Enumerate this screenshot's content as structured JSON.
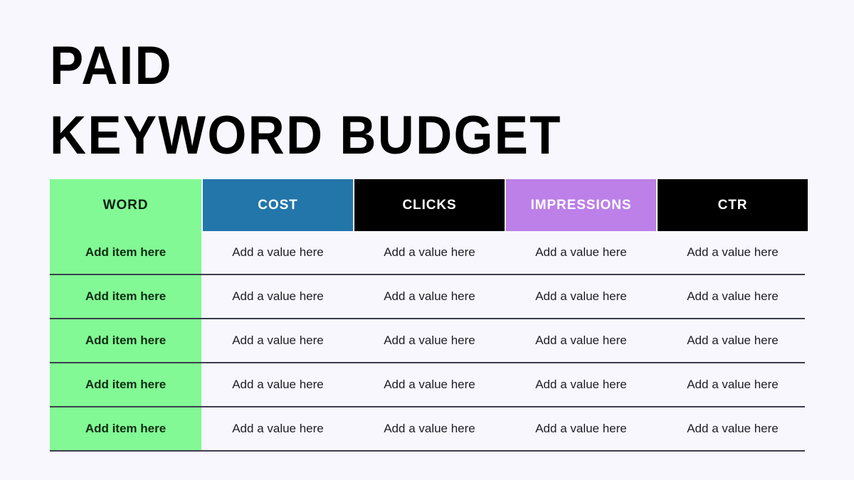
{
  "slide": {
    "background_color": "#f8f7fd",
    "title_lines": [
      "PAID",
      "KEYWORD BUDGET"
    ]
  },
  "table": {
    "columns": [
      {
        "key": "word",
        "label": "WORD",
        "bg": "#82f994",
        "fg": "#0a1f0e"
      },
      {
        "key": "cost",
        "label": "COST",
        "bg": "#2276a9",
        "fg": "#ffffff"
      },
      {
        "key": "clicks",
        "label": "CLICKS",
        "bg": "#000000",
        "fg": "#ffffff"
      },
      {
        "key": "impressions",
        "label": "IMPRESSIONS",
        "bg": "#bc80e8",
        "fg": "#ffffff"
      },
      {
        "key": "ctr",
        "label": "CTR",
        "bg": "#000000",
        "fg": "#ffffff"
      }
    ],
    "row_label_bg": "#82f994",
    "row_value_bg": "#f8f7fd",
    "row_divider_color": "#3d3d4e",
    "rows": [
      {
        "word": "Add item here",
        "cost": "Add a value here",
        "clicks": "Add a value here",
        "impressions": "Add a value here",
        "ctr": "Add a value here"
      },
      {
        "word": "Add item here",
        "cost": "Add a value here",
        "clicks": "Add a value here",
        "impressions": "Add a value here",
        "ctr": "Add a value here"
      },
      {
        "word": "Add item here",
        "cost": "Add a value here",
        "clicks": "Add a value here",
        "impressions": "Add a value here",
        "ctr": "Add a value here"
      },
      {
        "word": "Add item here",
        "cost": "Add a value here",
        "clicks": "Add a value here",
        "impressions": "Add a value here",
        "ctr": "Add a value here"
      },
      {
        "word": "Add item here",
        "cost": "Add a value here",
        "clicks": "Add a value here",
        "impressions": "Add a value here",
        "ctr": "Add a value here"
      }
    ]
  }
}
